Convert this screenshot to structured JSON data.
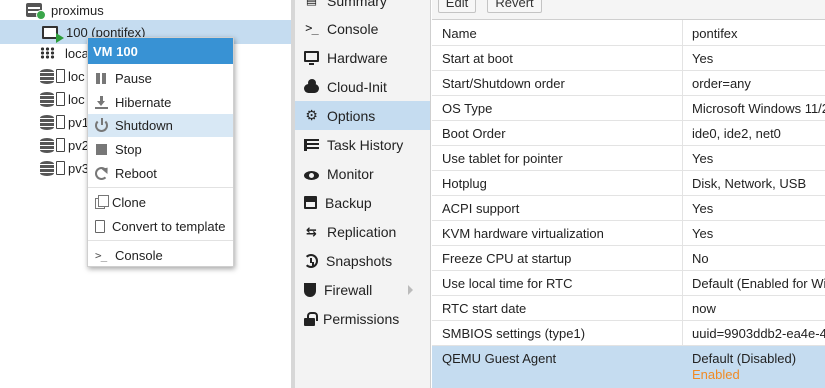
{
  "tree": {
    "node": "proximus",
    "vm": "100 (pontifex)",
    "items": [
      "loca",
      "loc",
      "loc",
      "pv1",
      "pv2",
      "pv3"
    ]
  },
  "context_menu": {
    "title": "VM 100",
    "items": [
      {
        "label": "Pause",
        "icon": "pause-icon"
      },
      {
        "label": "Hibernate",
        "icon": "hibernate-icon"
      },
      {
        "label": "Shutdown",
        "icon": "power-icon",
        "highlighted": true
      },
      {
        "label": "Stop",
        "icon": "stop-icon"
      },
      {
        "label": "Reboot",
        "icon": "reboot-icon"
      },
      {
        "label": "Clone",
        "icon": "clone-icon"
      },
      {
        "label": "Convert to template",
        "icon": "template-icon"
      },
      {
        "label": "Console",
        "icon": "terminal-icon"
      }
    ]
  },
  "nav": {
    "items": [
      {
        "label": "Summary"
      },
      {
        "label": "Console"
      },
      {
        "label": "Hardware"
      },
      {
        "label": "Cloud-Init"
      },
      {
        "label": "Options",
        "active": true
      },
      {
        "label": "Task History"
      },
      {
        "label": "Monitor"
      },
      {
        "label": "Backup"
      },
      {
        "label": "Replication"
      },
      {
        "label": "Snapshots"
      },
      {
        "label": "Firewall"
      },
      {
        "label": "Permissions"
      }
    ]
  },
  "toolbar": {
    "edit_label": "Edit",
    "revert_label": "Revert"
  },
  "options": [
    {
      "name": "Name",
      "value": "pontifex"
    },
    {
      "name": "Start at boot",
      "value": "Yes"
    },
    {
      "name": "Start/Shutdown order",
      "value": "order=any"
    },
    {
      "name": "OS Type",
      "value": "Microsoft Windows 11/2"
    },
    {
      "name": "Boot Order",
      "value": "ide0, ide2, net0"
    },
    {
      "name": "Use tablet for pointer",
      "value": "Yes"
    },
    {
      "name": "Hotplug",
      "value": "Disk, Network, USB"
    },
    {
      "name": "ACPI support",
      "value": "Yes"
    },
    {
      "name": "KVM hardware virtualization",
      "value": "Yes"
    },
    {
      "name": "Freeze CPU at startup",
      "value": "No"
    },
    {
      "name": "Use local time for RTC",
      "value": "Default (Enabled for Wi"
    },
    {
      "name": "RTC start date",
      "value": "now"
    },
    {
      "name": "SMBIOS settings (type1)",
      "value": "uuid=9903ddb2-ea4e-4"
    },
    {
      "name": "QEMU Guest Agent",
      "value": "Default (Disabled)",
      "pending": "Enabled"
    }
  ],
  "colors": {
    "selection": "#c5dcf0",
    "menu_title": "#3892d4",
    "pending": "#f08a24",
    "vm_running": "#2d9d3c"
  }
}
